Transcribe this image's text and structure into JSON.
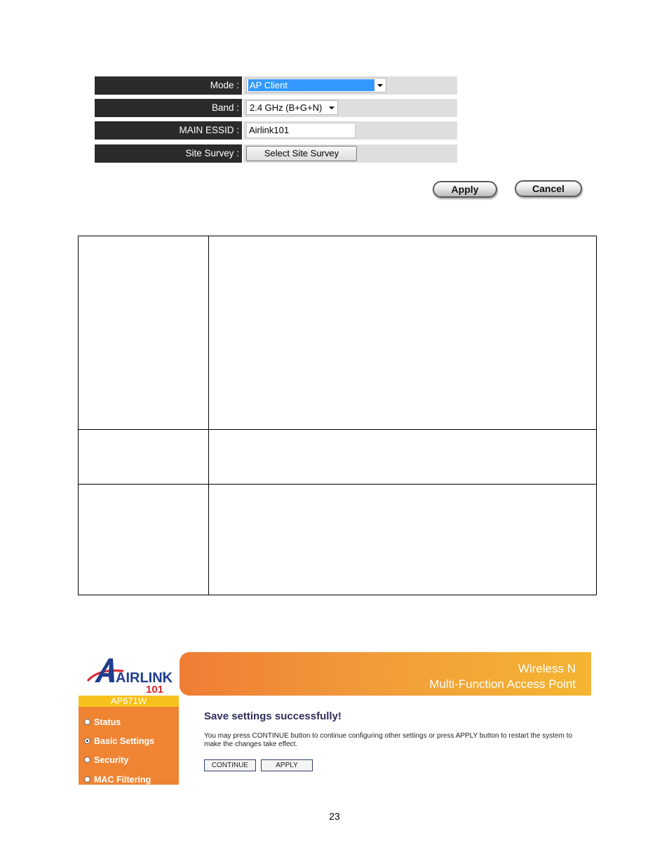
{
  "settings_form": {
    "rows": [
      {
        "label": "Mode :",
        "type": "select",
        "value": "AP Client"
      },
      {
        "label": "Band :",
        "type": "select",
        "value": "2.4 GHz (B+G+N)"
      },
      {
        "label": "MAIN ESSID :",
        "type": "text",
        "value": "Airlink101"
      },
      {
        "label": "Site Survey :",
        "type": "button",
        "value": "Select Site Survey"
      }
    ],
    "apply_label": "Apply",
    "cancel_label": "Cancel",
    "colors": {
      "label_bg": "#2b2b2b",
      "value_bg": "#dedede",
      "selection": "#3399ff"
    }
  },
  "doc_table": {
    "rows": [
      {
        "term": "",
        "description": ""
      },
      {
        "term": "",
        "description": ""
      },
      {
        "term": "",
        "description": ""
      }
    ]
  },
  "router_ui": {
    "logo": {
      "brand": "AIRLINK",
      "sub": "101",
      "registered": "®"
    },
    "banner": {
      "line1": "Wireless N",
      "line2": "Multi-Function Access Point"
    },
    "model": "AP671W",
    "menu": [
      {
        "label": "Status",
        "selected": false
      },
      {
        "label": "Basic Settings",
        "selected": true
      },
      {
        "label": "Security",
        "selected": false
      },
      {
        "label": "MAC Filtering",
        "selected": false
      }
    ],
    "title": "Save settings successfully!",
    "message": "You may press CONTINUE button to continue configuring other settings or press APPLY button to restart the system to make the changes take effect.",
    "continue_label": "CONTINUE",
    "apply_label": "APPLY",
    "colors": {
      "orange": "#ef8433",
      "yellow": "#f7c11d",
      "title": "#2e2e5a"
    }
  },
  "page_number": "23"
}
